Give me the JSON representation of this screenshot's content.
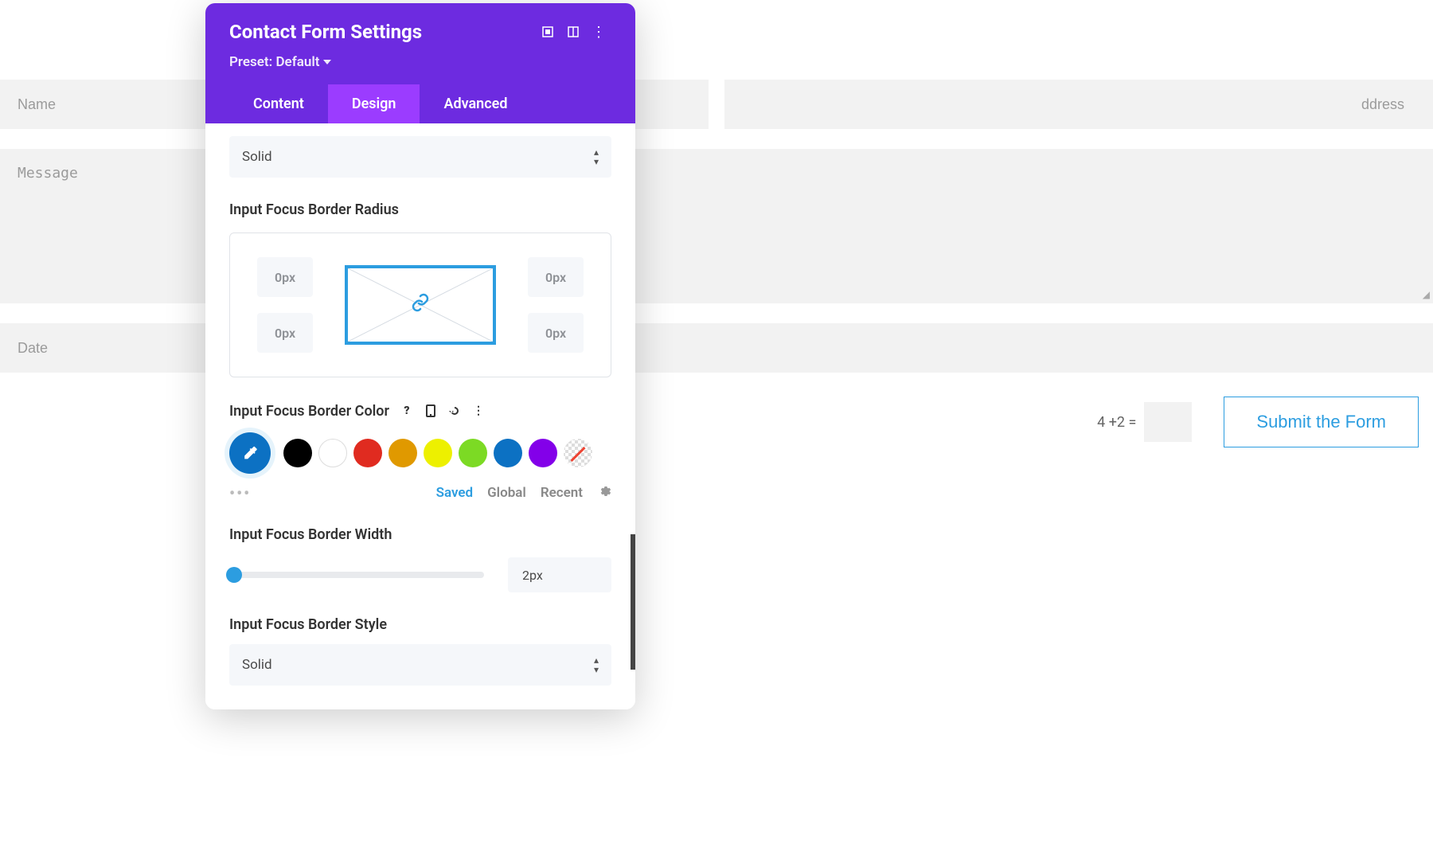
{
  "bg_form": {
    "name_placeholder": "Name",
    "email_placeholder": "ddress",
    "message_placeholder": "Message",
    "date_placeholder": "Date",
    "captcha": "4 +2 =",
    "submit": "Submit the Form"
  },
  "panel": {
    "title": "Contact Form Settings",
    "preset": "Preset: Default",
    "tabs": {
      "content": "Content",
      "design": "Design",
      "advanced": "Advanced"
    },
    "border_style_top": "Solid",
    "radius_label": "Input Focus Border Radius",
    "radius": {
      "tl": "0px",
      "tr": "0px",
      "bl": "0px",
      "br": "0px"
    },
    "color_label": "Input Focus Border Color",
    "palette": {
      "colors": [
        "#000000",
        "#ffffff",
        "#e02b20",
        "#e09900",
        "#edf000",
        "#7cda24",
        "#0c71c3",
        "#8300e9"
      ],
      "eyedrop": "#0c71c3",
      "saved": "Saved",
      "global": "Global",
      "recent": "Recent"
    },
    "width_label": "Input Focus Border Width",
    "width_value": "2px",
    "style_label": "Input Focus Border Style",
    "border_style_bottom": "Solid"
  }
}
